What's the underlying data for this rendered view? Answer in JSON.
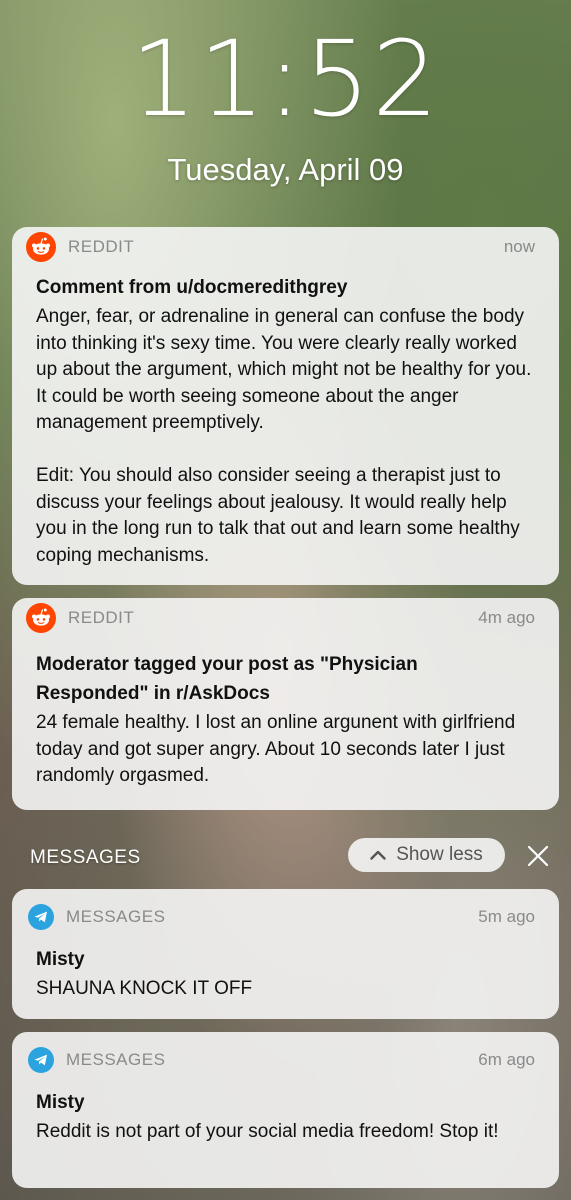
{
  "lockscreen": {
    "time": "11:52",
    "date": "Tuesday, April 09"
  },
  "notifications": [
    {
      "app": "REDDIT",
      "icon": "reddit-icon",
      "time": "now",
      "title": "Comment from u/docmeredithgrey",
      "body": "Anger, fear, or adrenaline in general can confuse the body into thinking it's sexy time. You were clearly really worked up about the argument, which might not be healthy for you. It could be worth seeing someone about the anger management preemptively.\n\nEdit: You should also consider seeing a therapist just to discuss your feelings about jealousy. It would really help you in the long run to talk that out and learn some healthy coping mechanisms."
    },
    {
      "app": "REDDIT",
      "icon": "reddit-icon",
      "time": "4m ago",
      "title": "Moderator tagged your post as \"Physician Responded\" in r/AskDocs",
      "body": "24 female healthy. I lost an online argunent with girlfriend today and got super angry. About 10 seconds later I just randomly orgasmed."
    },
    {
      "app": "MESSAGES",
      "icon": "telegram-icon",
      "time": "5m ago",
      "title": "Misty",
      "body": "SHAUNA KNOCK IT OFF"
    },
    {
      "app": "MESSAGES",
      "icon": "telegram-icon",
      "time": "6m ago",
      "title": "Misty",
      "body": "Reddit is not part of your social media freedom! Stop it!"
    }
  ],
  "group": {
    "label": "MESSAGES",
    "show_less_label": "Show less",
    "close_icon": "close-icon"
  },
  "colors": {
    "reddit": "#ff4500",
    "telegram": "#2aa3df",
    "card_bg": "#f5f5f5"
  }
}
